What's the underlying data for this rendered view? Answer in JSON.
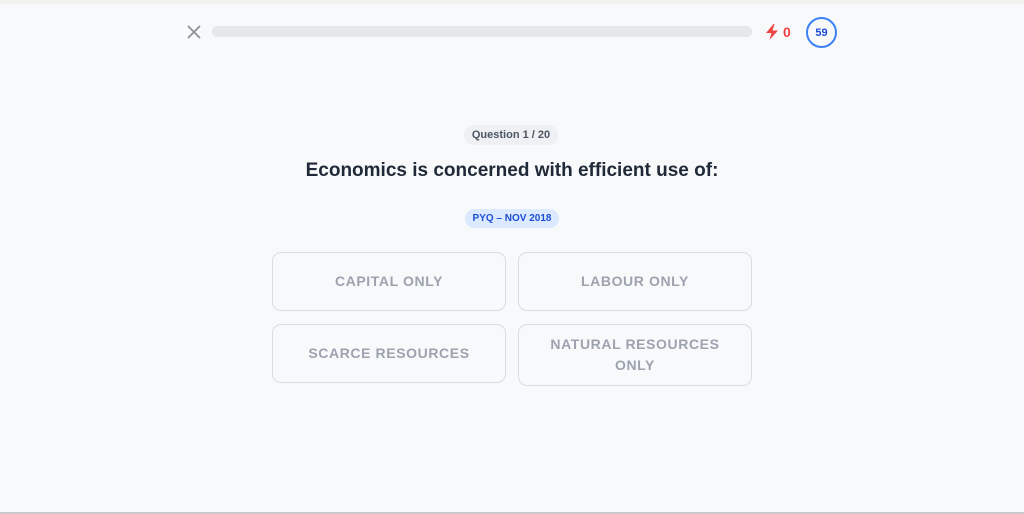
{
  "header": {
    "close_icon": "close-icon",
    "progress_fraction": 0.0,
    "streak": {
      "icon": "lightning-icon",
      "count": "0"
    },
    "timer": "59"
  },
  "quiz": {
    "counter": "Question 1 / 20",
    "question": "Economics is concerned with efficient use of:",
    "source_tag": "PYQ – NOV 2018",
    "options": [
      {
        "label": "CAPITAL ONLY"
      },
      {
        "label": "LABOUR ONLY"
      },
      {
        "label": "SCARCE RESOURCES"
      },
      {
        "label": "NATURAL RESOURCES ONLY"
      }
    ]
  },
  "colors": {
    "accent_red": "#ef4444",
    "accent_blue": "#3b82f6",
    "tag_bg": "#dbeafe",
    "option_border": "#d9dce1",
    "option_text": "#9ca3af"
  }
}
